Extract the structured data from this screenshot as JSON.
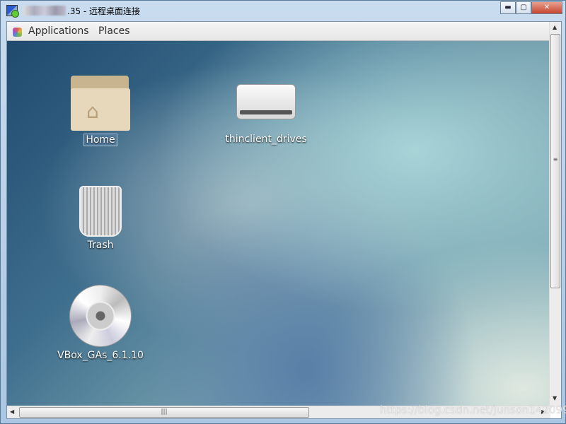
{
  "window": {
    "title_suffix": ".35 - 远程桌面连接",
    "minimize": "▬",
    "maximize": "▢",
    "close": "✕"
  },
  "topbar": {
    "applications": "Applications",
    "places": "Places"
  },
  "desktop": {
    "icons": [
      {
        "label": "Home",
        "icon": "home-folder-icon",
        "selected": true
      },
      {
        "label": "thinclient_drives",
        "icon": "drive-icon"
      },
      {
        "label": "Trash",
        "icon": "trash-icon"
      },
      {
        "label": "VBox_GAs_6.1.10",
        "icon": "cd-icon"
      }
    ]
  },
  "watermark": "https://blog.csdn.net/Junson142099"
}
